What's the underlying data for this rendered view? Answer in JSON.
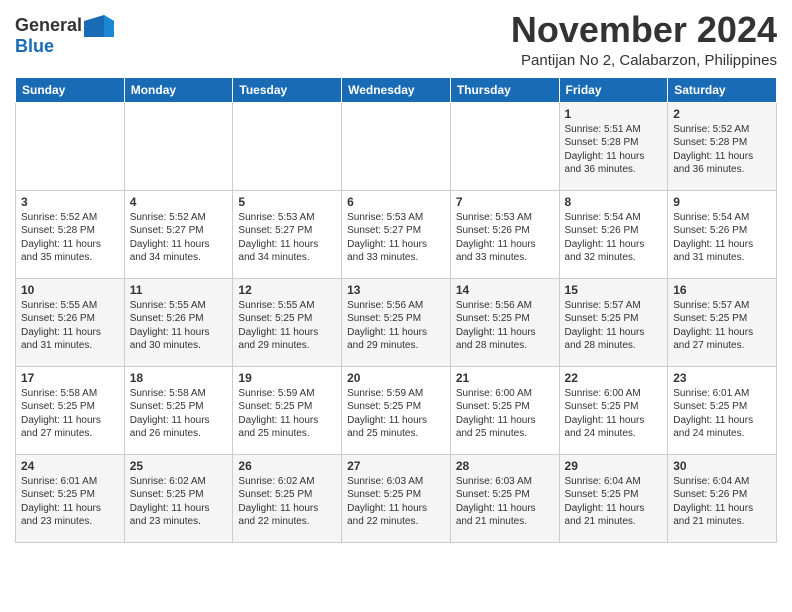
{
  "header": {
    "logo_line1": "General",
    "logo_line2": "Blue",
    "month_title": "November 2024",
    "location": "Pantijan No 2, Calabarzon, Philippines"
  },
  "weekdays": [
    "Sunday",
    "Monday",
    "Tuesday",
    "Wednesday",
    "Thursday",
    "Friday",
    "Saturday"
  ],
  "weeks": [
    [
      {
        "day": "",
        "info": ""
      },
      {
        "day": "",
        "info": ""
      },
      {
        "day": "",
        "info": ""
      },
      {
        "day": "",
        "info": ""
      },
      {
        "day": "",
        "info": ""
      },
      {
        "day": "1",
        "info": "Sunrise: 5:51 AM\nSunset: 5:28 PM\nDaylight: 11 hours\nand 36 minutes."
      },
      {
        "day": "2",
        "info": "Sunrise: 5:52 AM\nSunset: 5:28 PM\nDaylight: 11 hours\nand 36 minutes."
      }
    ],
    [
      {
        "day": "3",
        "info": "Sunrise: 5:52 AM\nSunset: 5:28 PM\nDaylight: 11 hours\nand 35 minutes."
      },
      {
        "day": "4",
        "info": "Sunrise: 5:52 AM\nSunset: 5:27 PM\nDaylight: 11 hours\nand 34 minutes."
      },
      {
        "day": "5",
        "info": "Sunrise: 5:53 AM\nSunset: 5:27 PM\nDaylight: 11 hours\nand 34 minutes."
      },
      {
        "day": "6",
        "info": "Sunrise: 5:53 AM\nSunset: 5:27 PM\nDaylight: 11 hours\nand 33 minutes."
      },
      {
        "day": "7",
        "info": "Sunrise: 5:53 AM\nSunset: 5:26 PM\nDaylight: 11 hours\nand 33 minutes."
      },
      {
        "day": "8",
        "info": "Sunrise: 5:54 AM\nSunset: 5:26 PM\nDaylight: 11 hours\nand 32 minutes."
      },
      {
        "day": "9",
        "info": "Sunrise: 5:54 AM\nSunset: 5:26 PM\nDaylight: 11 hours\nand 31 minutes."
      }
    ],
    [
      {
        "day": "10",
        "info": "Sunrise: 5:55 AM\nSunset: 5:26 PM\nDaylight: 11 hours\nand 31 minutes."
      },
      {
        "day": "11",
        "info": "Sunrise: 5:55 AM\nSunset: 5:26 PM\nDaylight: 11 hours\nand 30 minutes."
      },
      {
        "day": "12",
        "info": "Sunrise: 5:55 AM\nSunset: 5:25 PM\nDaylight: 11 hours\nand 29 minutes."
      },
      {
        "day": "13",
        "info": "Sunrise: 5:56 AM\nSunset: 5:25 PM\nDaylight: 11 hours\nand 29 minutes."
      },
      {
        "day": "14",
        "info": "Sunrise: 5:56 AM\nSunset: 5:25 PM\nDaylight: 11 hours\nand 28 minutes."
      },
      {
        "day": "15",
        "info": "Sunrise: 5:57 AM\nSunset: 5:25 PM\nDaylight: 11 hours\nand 28 minutes."
      },
      {
        "day": "16",
        "info": "Sunrise: 5:57 AM\nSunset: 5:25 PM\nDaylight: 11 hours\nand 27 minutes."
      }
    ],
    [
      {
        "day": "17",
        "info": "Sunrise: 5:58 AM\nSunset: 5:25 PM\nDaylight: 11 hours\nand 27 minutes."
      },
      {
        "day": "18",
        "info": "Sunrise: 5:58 AM\nSunset: 5:25 PM\nDaylight: 11 hours\nand 26 minutes."
      },
      {
        "day": "19",
        "info": "Sunrise: 5:59 AM\nSunset: 5:25 PM\nDaylight: 11 hours\nand 25 minutes."
      },
      {
        "day": "20",
        "info": "Sunrise: 5:59 AM\nSunset: 5:25 PM\nDaylight: 11 hours\nand 25 minutes."
      },
      {
        "day": "21",
        "info": "Sunrise: 6:00 AM\nSunset: 5:25 PM\nDaylight: 11 hours\nand 25 minutes."
      },
      {
        "day": "22",
        "info": "Sunrise: 6:00 AM\nSunset: 5:25 PM\nDaylight: 11 hours\nand 24 minutes."
      },
      {
        "day": "23",
        "info": "Sunrise: 6:01 AM\nSunset: 5:25 PM\nDaylight: 11 hours\nand 24 minutes."
      }
    ],
    [
      {
        "day": "24",
        "info": "Sunrise: 6:01 AM\nSunset: 5:25 PM\nDaylight: 11 hours\nand 23 minutes."
      },
      {
        "day": "25",
        "info": "Sunrise: 6:02 AM\nSunset: 5:25 PM\nDaylight: 11 hours\nand 23 minutes."
      },
      {
        "day": "26",
        "info": "Sunrise: 6:02 AM\nSunset: 5:25 PM\nDaylight: 11 hours\nand 22 minutes."
      },
      {
        "day": "27",
        "info": "Sunrise: 6:03 AM\nSunset: 5:25 PM\nDaylight: 11 hours\nand 22 minutes."
      },
      {
        "day": "28",
        "info": "Sunrise: 6:03 AM\nSunset: 5:25 PM\nDaylight: 11 hours\nand 21 minutes."
      },
      {
        "day": "29",
        "info": "Sunrise: 6:04 AM\nSunset: 5:25 PM\nDaylight: 11 hours\nand 21 minutes."
      },
      {
        "day": "30",
        "info": "Sunrise: 6:04 AM\nSunset: 5:26 PM\nDaylight: 11 hours\nand 21 minutes."
      }
    ]
  ]
}
